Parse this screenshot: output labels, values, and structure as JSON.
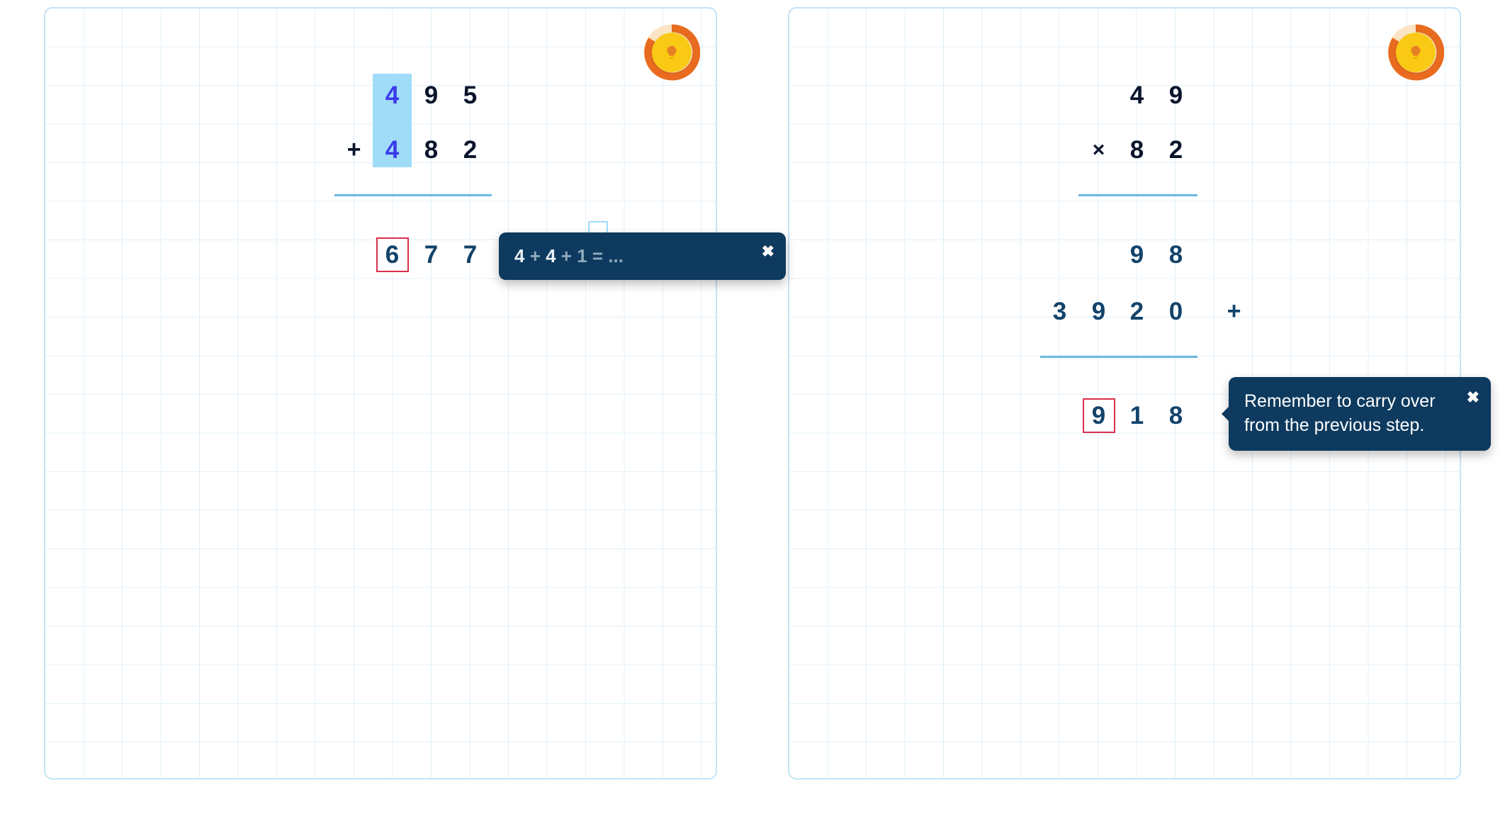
{
  "left": {
    "row1": {
      "d1": "4",
      "d2": "9",
      "d3": "5"
    },
    "row2": {
      "op": "+",
      "d1": "4",
      "d2": "8",
      "d3": "2"
    },
    "result": {
      "err": "6",
      "d2": "7",
      "d3": "7"
    },
    "tooltip": {
      "a": "4",
      "plus1": " + ",
      "b": "4",
      "plus2": " + ",
      "c": "1",
      "rest": " = ..."
    }
  },
  "right": {
    "row1": {
      "d1": "4",
      "d2": "9"
    },
    "row2": {
      "op": "×",
      "d1": "8",
      "d2": "2"
    },
    "partial1": {
      "d1": "9",
      "d2": "8"
    },
    "partial2": {
      "d1": "3",
      "d2": "9",
      "d3": "2",
      "d4": "0",
      "op": "+"
    },
    "result": {
      "err": "9",
      "d2": "1",
      "d3": "8"
    },
    "tooltip": {
      "text": "Remember to carry over from the previous step."
    }
  },
  "icons": {
    "close": "✖"
  }
}
